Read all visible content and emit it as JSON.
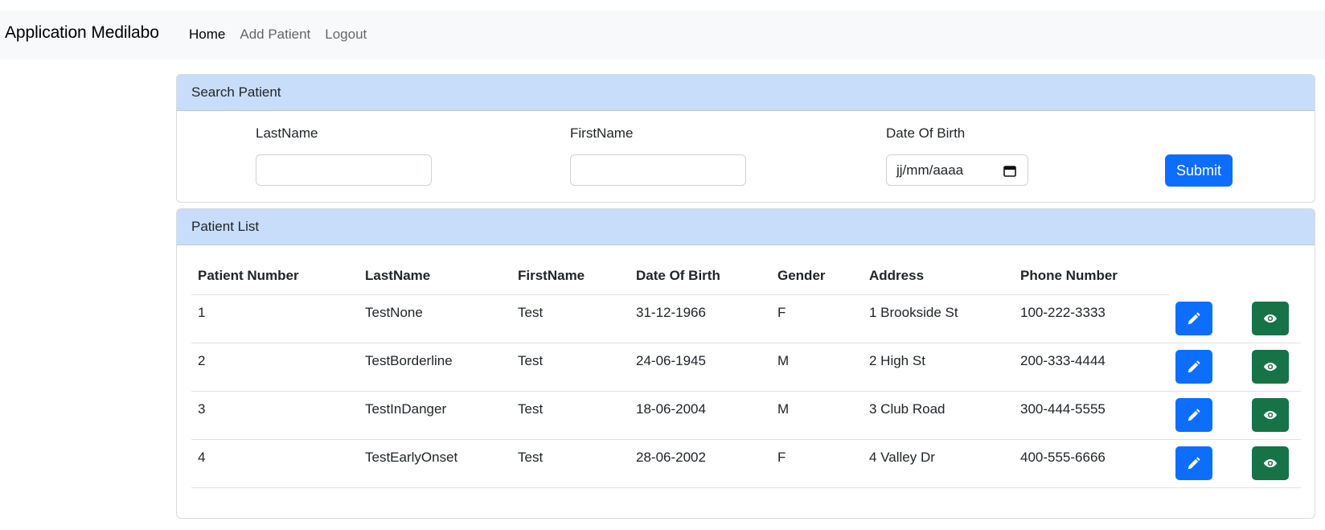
{
  "navbar": {
    "brand": "Application Medilabo",
    "links": [
      {
        "label": "Home",
        "active": true
      },
      {
        "label": "Add Patient",
        "active": false
      },
      {
        "label": "Logout",
        "active": false
      }
    ]
  },
  "search": {
    "title": "Search Patient",
    "lastname_label": "LastName",
    "lastname_value": "",
    "firstname_label": "FirstName",
    "firstname_value": "",
    "dob_label": "Date Of Birth",
    "dob_placeholder": "jj/mm/aaaa",
    "submit_label": "Submit"
  },
  "list": {
    "title": "Patient List",
    "columns": [
      "Patient Number",
      "LastName",
      "FirstName",
      "Date Of Birth",
      "Gender",
      "Address",
      "Phone Number"
    ],
    "rows": [
      {
        "number": "1",
        "lastname": "TestNone",
        "firstname": "Test",
        "dob": "31-12-1966",
        "gender": "F",
        "address": "1 Brookside St",
        "phone": "100-222-3333"
      },
      {
        "number": "2",
        "lastname": "TestBorderline",
        "firstname": "Test",
        "dob": "24-06-1945",
        "gender": "M",
        "address": "2 High St",
        "phone": "200-333-4444"
      },
      {
        "number": "3",
        "lastname": "TestInDanger",
        "firstname": "Test",
        "dob": "18-06-2004",
        "gender": "M",
        "address": "3 Club Road",
        "phone": "300-444-5555"
      },
      {
        "number": "4",
        "lastname": "TestEarlyOnset",
        "firstname": "Test",
        "dob": "28-06-2002",
        "gender": "F",
        "address": "4 Valley Dr",
        "phone": "400-555-6666"
      }
    ],
    "row_actions": [
      {
        "icon": "pencil-icon",
        "color": "#0d6efd"
      },
      {
        "icon": "eye-icon",
        "color": "#157347"
      }
    ]
  },
  "colors": {
    "primary": "#0d6efd",
    "success": "#157347",
    "card_header": "#c8ddfa",
    "navbar": "#f8f9fa"
  }
}
